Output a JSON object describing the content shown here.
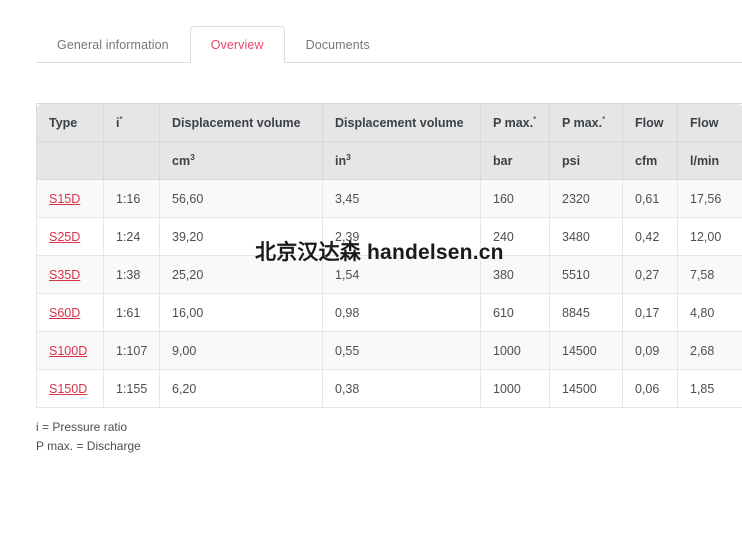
{
  "tabs": [
    {
      "label": "General information",
      "active": false
    },
    {
      "label": "Overview",
      "active": true
    },
    {
      "label": "Documents",
      "active": false
    }
  ],
  "colors": {
    "active_tab_text": "#e8486b",
    "link": "#d6334c",
    "header_bg": "#e6e6e6",
    "row_alt_bg": "#f9f9f9",
    "border": "#e2e2e2"
  },
  "table": {
    "headers_main": [
      "Type",
      "i",
      "Displacement volume",
      "Displacement volume",
      "P max.",
      "P max.",
      "Flow",
      "Flow"
    ],
    "headers_footnote_marks": [
      "",
      "*",
      "",
      "",
      "*",
      "*",
      "",
      ""
    ],
    "headers_units": [
      "",
      "",
      "cm",
      "in",
      "bar",
      "psi",
      "cfm",
      "l/min"
    ],
    "headers_units_sup": [
      "",
      "",
      "3",
      "3",
      "",
      "",
      "",
      ""
    ],
    "rows": [
      {
        "type": "S15D",
        "i": "1:16",
        "cm3": "56,60",
        "in3": "3,45",
        "bar": "160",
        "psi": "2320",
        "cfm": "0,61",
        "lmin": "17,56"
      },
      {
        "type": "S25D",
        "i": "1:24",
        "cm3": "39,20",
        "in3": "2,39",
        "bar": "240",
        "psi": "3480",
        "cfm": "0,42",
        "lmin": "12,00"
      },
      {
        "type": "S35D",
        "i": "1:38",
        "cm3": "25,20",
        "in3": "1,54",
        "bar": "380",
        "psi": "5510",
        "cfm": "0,27",
        "lmin": "7,58"
      },
      {
        "type": "S60D",
        "i": "1:61",
        "cm3": "16,00",
        "in3": "0,98",
        "bar": "610",
        "psi": "8845",
        "cfm": "0,17",
        "lmin": "4,80"
      },
      {
        "type": "S100D",
        "i": "1:107",
        "cm3": "9,00",
        "in3": "0,55",
        "bar": "1000",
        "psi": "14500",
        "cfm": "0,09",
        "lmin": "2,68"
      },
      {
        "type": "S150D",
        "i": "1:155",
        "cm3": "6,20",
        "in3": "0,38",
        "bar": "1000",
        "psi": "14500",
        "cfm": "0,06",
        "lmin": "1,85"
      }
    ]
  },
  "footnotes": [
    "i = Pressure ratio",
    "P max. = Discharge"
  ],
  "watermark": {
    "text": "北京汉达森 handelsen.cn"
  }
}
